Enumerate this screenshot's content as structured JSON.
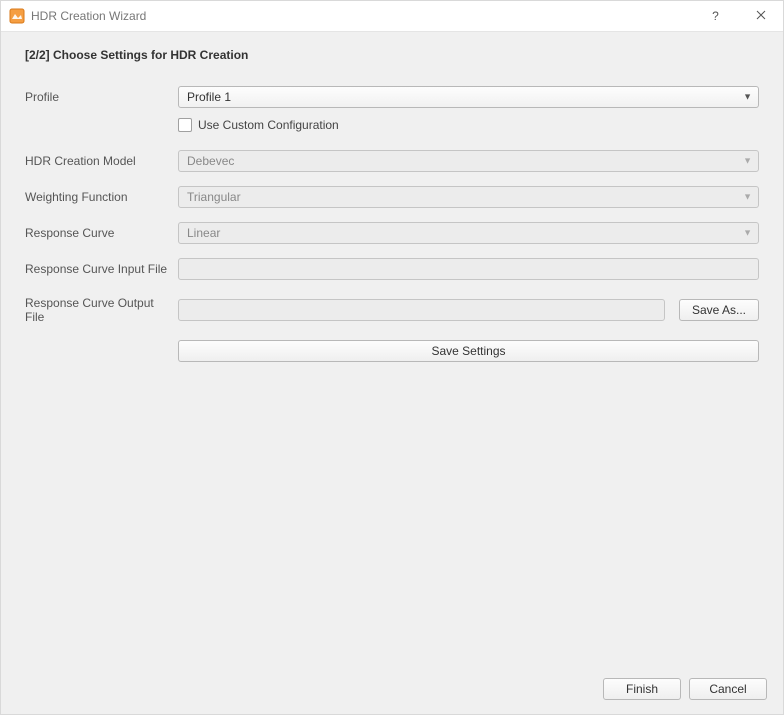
{
  "window": {
    "title": "HDR Creation Wizard"
  },
  "step": {
    "title": "[2/2] Choose Settings for HDR Creation"
  },
  "labels": {
    "profile": "Profile",
    "custom_config": "Use Custom Configuration",
    "model": "HDR Creation Model",
    "weighting": "Weighting Function",
    "response_curve": "Response Curve",
    "curve_input": "Response Curve Input File",
    "curve_output": "Response Curve Output File"
  },
  "values": {
    "profile": "Profile 1",
    "model": "Debevec",
    "weighting": "Triangular",
    "response_curve": "Linear",
    "curve_input": "",
    "curve_output": ""
  },
  "buttons": {
    "save_as": "Save As...",
    "save_settings": "Save Settings",
    "finish": "Finish",
    "cancel": "Cancel"
  }
}
